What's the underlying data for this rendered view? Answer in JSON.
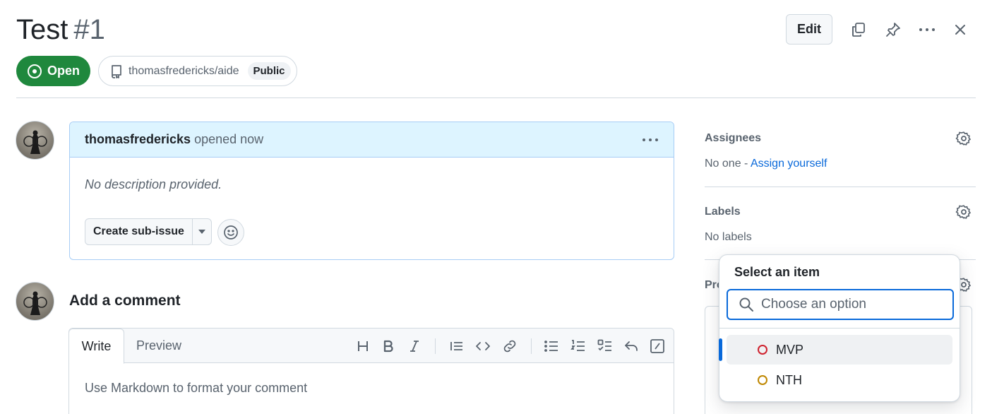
{
  "issue": {
    "title": "Test",
    "number": "#1",
    "state": "Open"
  },
  "header": {
    "edit_label": "Edit"
  },
  "repo": {
    "name": "thomasfredericks/aide",
    "visibility": "Public"
  },
  "comment": {
    "author": "thomasfredericks",
    "meta": "opened now",
    "body": "No description provided.",
    "create_subissue_label": "Create sub-issue"
  },
  "add_comment": {
    "heading": "Add a comment",
    "tabs": [
      "Write",
      "Preview"
    ],
    "placeholder": "Use Markdown to format your comment"
  },
  "sidebar": {
    "assignees": {
      "heading": "Assignees",
      "none_text": "No one - ",
      "assign_link": "Assign yourself"
    },
    "labels": {
      "heading": "Labels",
      "none_text": "No labels"
    },
    "projects": {
      "heading": "Pro"
    }
  },
  "popover": {
    "title": "Select an item",
    "search_placeholder": "Choose an option",
    "options": [
      {
        "label": "MVP",
        "color": "#cf222e",
        "selected": true
      },
      {
        "label": "NTH",
        "color": "#bf8700",
        "selected": false
      }
    ]
  },
  "colors": {
    "accent": "#0969da",
    "open_green": "#1f883d",
    "text_muted": "#59636e"
  }
}
